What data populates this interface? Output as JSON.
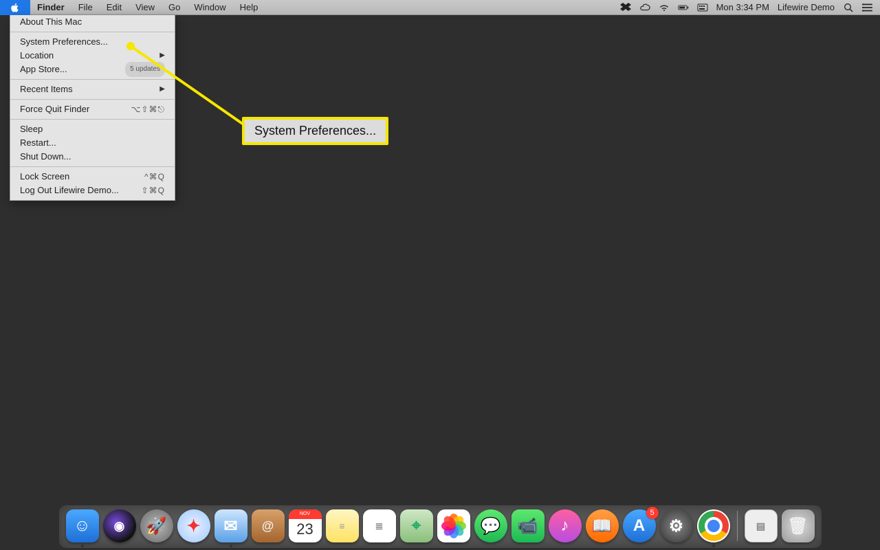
{
  "menubar": {
    "app": "Finder",
    "items": [
      "File",
      "Edit",
      "View",
      "Go",
      "Window",
      "Help"
    ],
    "right": {
      "clock": "Mon 3:34 PM",
      "user": "Lifewire Demo"
    }
  },
  "apple_menu": {
    "about": "About This Mac",
    "sysprefs": "System Preferences...",
    "location": "Location",
    "appstore": "App Store...",
    "appstore_badge": "5 updates",
    "recent": "Recent Items",
    "forcequit": "Force Quit Finder",
    "forcequit_shortcut": "⌥⇧⌘⎋",
    "sleep": "Sleep",
    "restart": "Restart...",
    "shutdown": "Shut Down...",
    "lockscreen": "Lock Screen",
    "lockscreen_shortcut": "^⌘Q",
    "logout": "Log Out Lifewire Demo...",
    "logout_shortcut": "⇧⌘Q"
  },
  "callout": {
    "text": "System Preferences..."
  },
  "dock": {
    "calendar_month": "NOV",
    "calendar_day": "23",
    "appstore_badge": "5",
    "items": [
      {
        "name": "finder",
        "running": true
      },
      {
        "name": "siri"
      },
      {
        "name": "launchpad"
      },
      {
        "name": "safari"
      },
      {
        "name": "mail",
        "running": true
      },
      {
        "name": "contacts"
      },
      {
        "name": "calendar"
      },
      {
        "name": "notes"
      },
      {
        "name": "reminders"
      },
      {
        "name": "maps"
      },
      {
        "name": "photos"
      },
      {
        "name": "messages"
      },
      {
        "name": "facetime"
      },
      {
        "name": "itunes"
      },
      {
        "name": "ibooks"
      },
      {
        "name": "appstore",
        "badge": "5"
      },
      {
        "name": "sysprefs"
      },
      {
        "name": "chrome",
        "running": true
      }
    ]
  }
}
